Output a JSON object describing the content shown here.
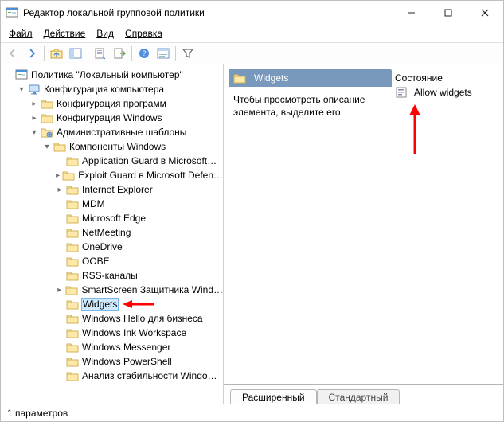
{
  "window": {
    "title": "Редактор локальной групповой политики"
  },
  "menu": {
    "file": "Файл",
    "action": "Действие",
    "view": "Вид",
    "help": "Справка"
  },
  "tree": {
    "root": "Политика \"Локальный компьютер\"",
    "comp_conf": "Конфигурация компьютера",
    "soft_conf": "Конфигурация программ",
    "win_conf": "Конфигурация Windows",
    "admin_templ": "Административные шаблоны",
    "win_components": "Компоненты Windows",
    "items": [
      "Application Guard в Microsoft…",
      "Exploit Guard в Microsoft Defen…",
      "Internet Explorer",
      "MDM",
      "Microsoft Edge",
      "NetMeeting",
      "OneDrive",
      "OOBE",
      "RSS-каналы",
      "SmartScreen Защитника Wind…",
      "Widgets",
      "Windows Hello для бизнеса",
      "Windows Ink Workspace",
      "Windows Messenger",
      "Windows PowerShell",
      "Анализ стабильности Windo…"
    ],
    "has_expander": [
      false,
      true,
      true,
      false,
      false,
      false,
      false,
      false,
      false,
      true,
      false,
      false,
      false,
      false,
      false,
      false
    ]
  },
  "detail": {
    "folder_title": "Widgets",
    "description": "Чтобы просмотреть описание элемента, выделите его.",
    "state_header": "Состояние",
    "setting": "Allow widgets"
  },
  "tabs": {
    "extended": "Расширенный",
    "standard": "Стандартный"
  },
  "status": "1 параметров"
}
